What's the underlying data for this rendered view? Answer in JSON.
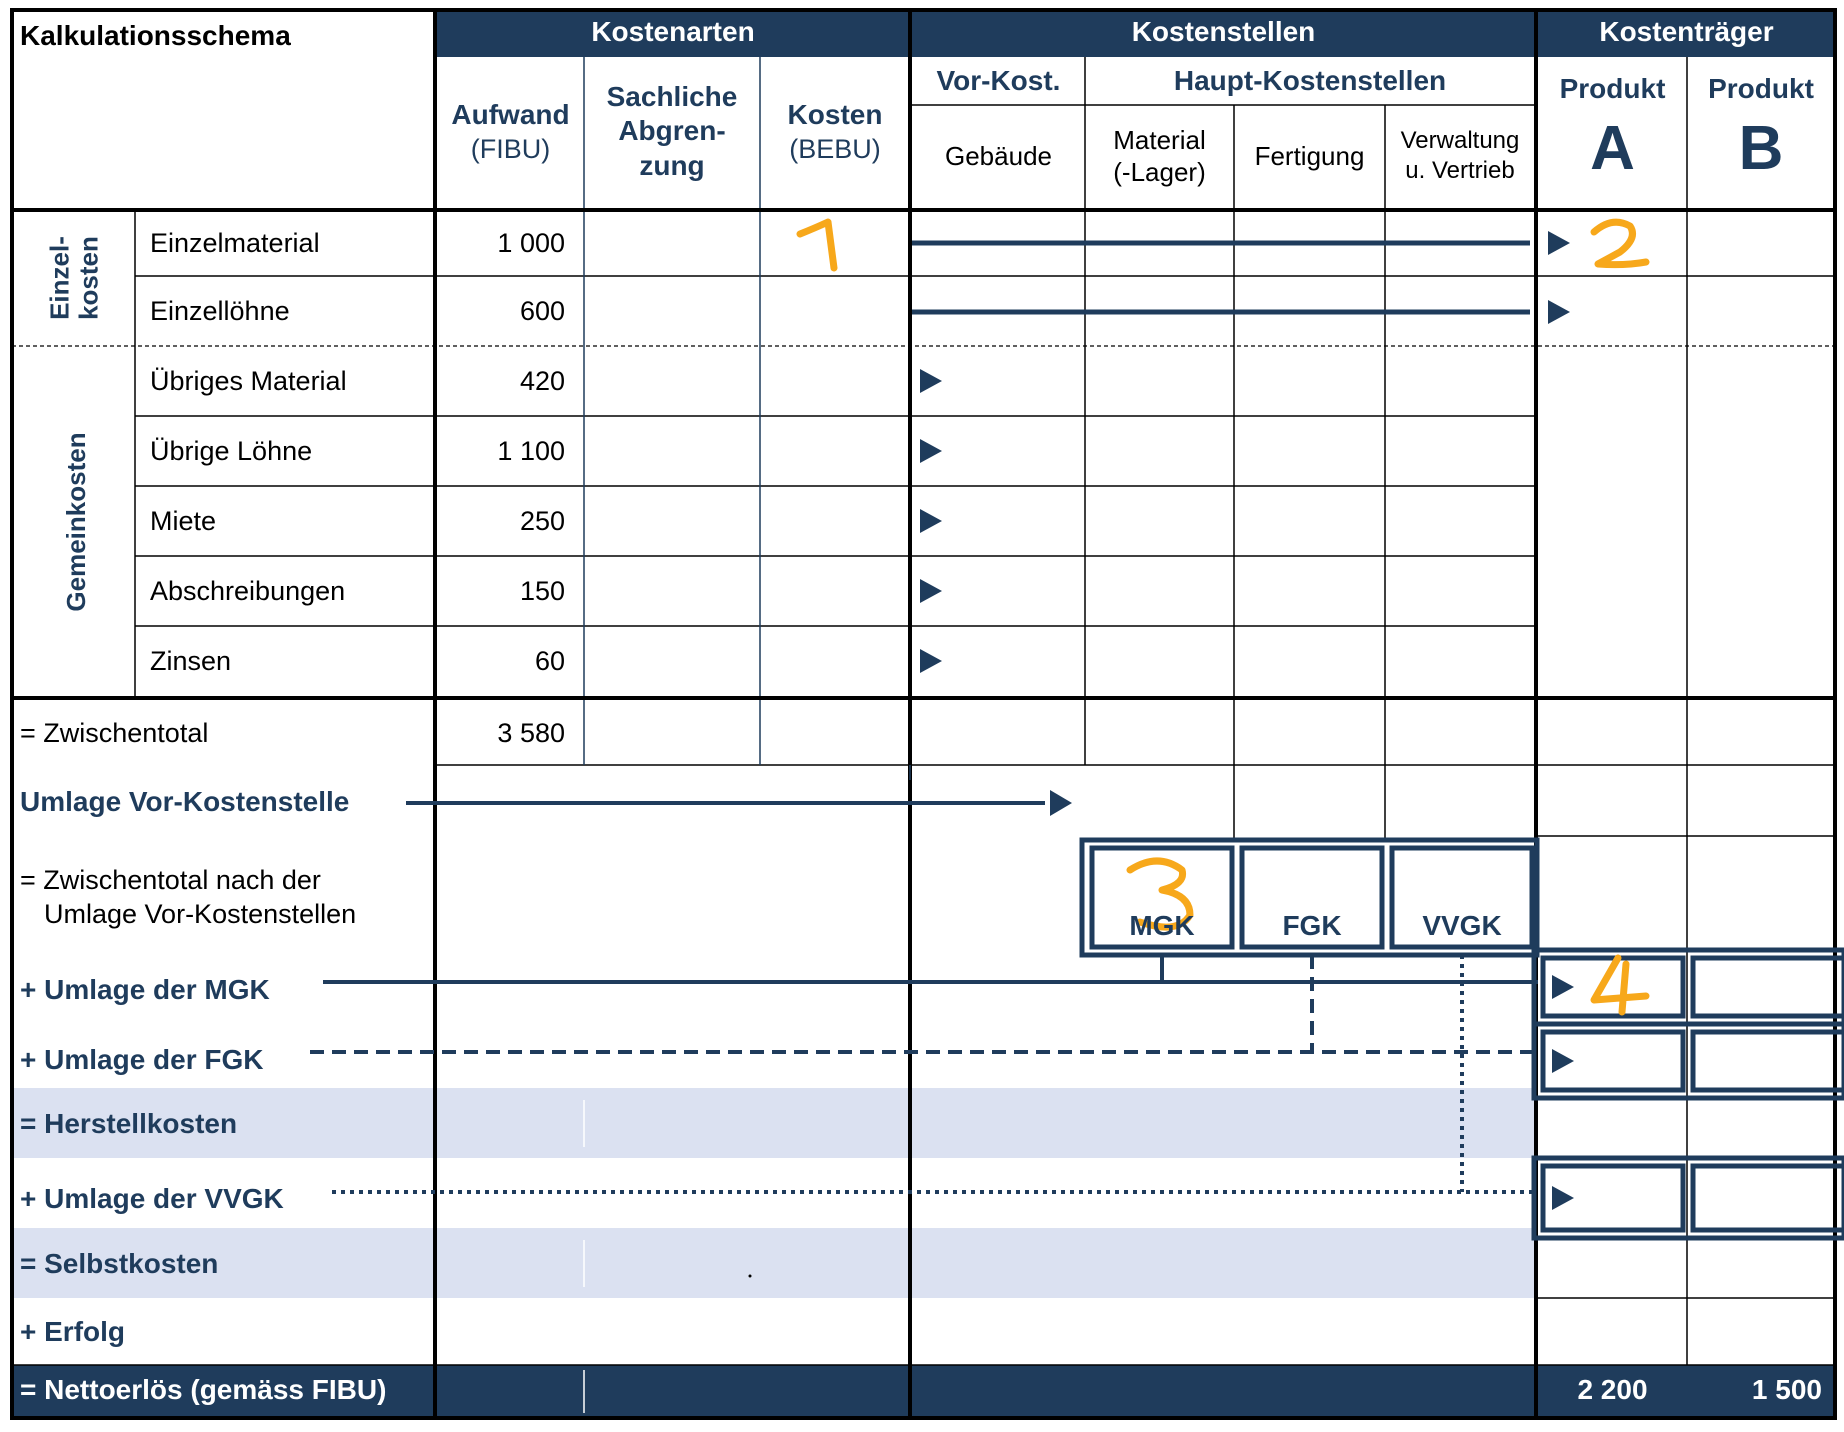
{
  "title": "Kalkulationsschema",
  "groups": {
    "kostenarten": "Kostenarten",
    "kostenstellen": "Kostenstellen",
    "kostentraeger": "Kostenträger"
  },
  "columns": {
    "aufwand": "Aufwand",
    "aufwand_sub": "(FIBU)",
    "sachliche_1": "Sachliche",
    "sachliche_2": "Abgren-",
    "sachliche_3": "zung",
    "kosten": "Kosten",
    "kosten_sub": "(BEBU)",
    "vor_kost": "Vor-Kost.",
    "haupt_kostenstellen": "Haupt-Kostenstellen",
    "gebaeude": "Gebäude",
    "material_1": "Material",
    "material_2": "(-Lager)",
    "fertigung": "Fertigung",
    "verwaltung_1": "Verwaltung",
    "verwaltung_2": "u. Vertrieb",
    "produkt_a_label": "Produkt",
    "produkt_a_letter": "A",
    "produkt_b_label": "Produkt",
    "produkt_b_letter": "B"
  },
  "side_labels": {
    "einzelkosten_1": "Einzel-",
    "einzelkosten_2": "kosten",
    "gemeinkosten": "Gemeinkosten"
  },
  "rows": [
    {
      "label": "Einzelmaterial",
      "aufwand": "1 000"
    },
    {
      "label": "Einzellöhne",
      "aufwand": "600"
    },
    {
      "label": "Übriges Material",
      "aufwand": "420"
    },
    {
      "label": "Übrige Löhne",
      "aufwand": "1 100"
    },
    {
      "label": "Miete",
      "aufwand": "250"
    },
    {
      "label": "Abschreibungen",
      "aufwand": "150"
    },
    {
      "label": "Zinsen",
      "aufwand": "60"
    }
  ],
  "lower": {
    "zwischentotal": "= Zwischentotal",
    "zwischentotal_value": "3 580",
    "umlage_vor": "Umlage Vor-Kostenstelle",
    "zwischentotal_nach_1": "= Zwischentotal nach der",
    "zwischentotal_nach_2": "Umlage Vor-Kostenstellen",
    "umlage_mgk": "+ Umlage der MGK",
    "umlage_fgk": "+ Umlage der FGK",
    "herstellkosten": "= Herstellkosten",
    "umlage_vvgk": "+ Umlage der VVGK",
    "selbstkosten": "= Selbstkosten",
    "erfolg": "+ Erfolg",
    "nettoerloes": "= Nettoerlös (gemäss FIBU)",
    "netto_a": "2 200",
    "netto_b": "1 500"
  },
  "boxes": {
    "mgk": "MGK",
    "fgk": "FGK",
    "vvgk": "VVGK"
  },
  "annotations": [
    "1",
    "2",
    "3",
    "4"
  ],
  "colors": {
    "navy": "#1f3c5c",
    "highlight": "#dbe1f1",
    "annotation": "#f7a81b"
  }
}
